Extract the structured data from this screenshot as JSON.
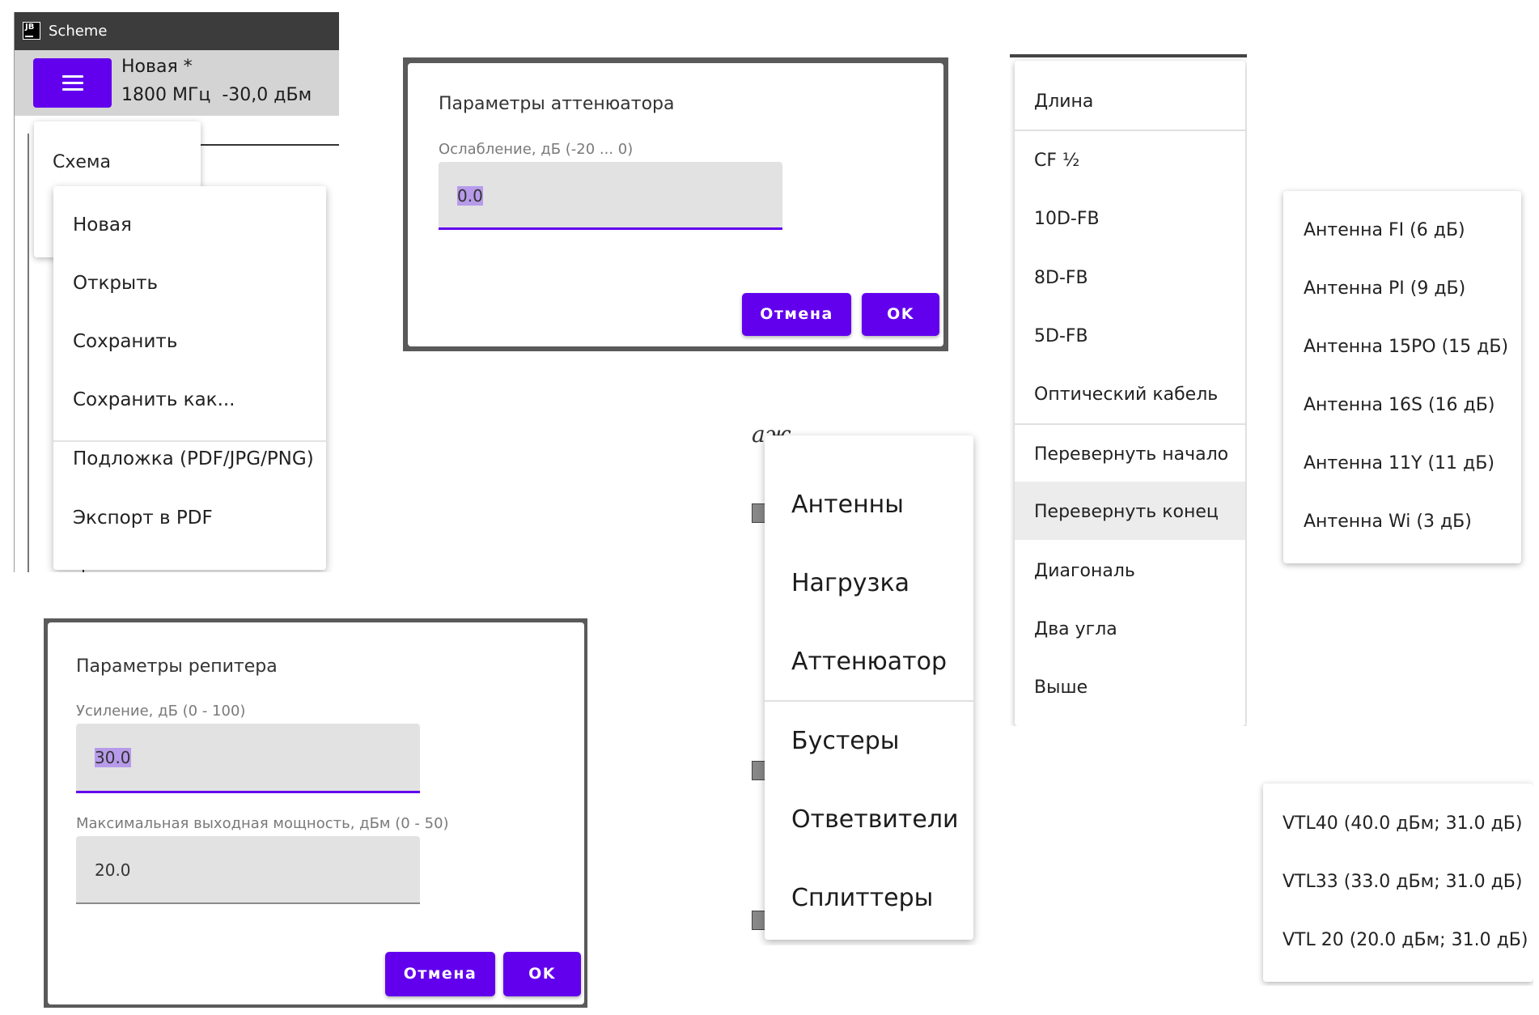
{
  "app_window": {
    "title": "Scheme",
    "logo": "JB",
    "document": {
      "name": "Новая *",
      "frequency": "1800 МГц",
      "level": "-30,0 дБм"
    },
    "menu_button_icon": "hamburger-icon",
    "top_menu": {
      "items": [
        "Схема"
      ]
    },
    "file_menu": {
      "items": [
        "Новая",
        "Открыть",
        "Сохранить",
        "Сохранить как...",
        "Подложка (PDF/JPG/PNG)",
        "Экспорт в PDF"
      ]
    }
  },
  "attenuator_dialog": {
    "title": "Параметры аттенюатора",
    "field_label": "Ослабление, дБ (-20 ... 0)",
    "field_value": "0.0",
    "cancel_label": "Отмена",
    "ok_label": "OK"
  },
  "repeater_dialog": {
    "title": "Параметры репитера",
    "gain_label": "Усиление, дБ (0 - 100)",
    "gain_value": "30.0",
    "power_label": "Максимальная выходная мощность, дБм (0 - 50)",
    "power_value": "20.0",
    "cancel_label": "Отмена",
    "ok_label": "OK"
  },
  "category_menu": {
    "background_text": "аж",
    "items": [
      "Антенны",
      "Нагрузка",
      "Аттенюатор",
      "Бустеры",
      "Ответвители",
      "Сплиттеры"
    ]
  },
  "cable_menu": {
    "items": [
      "Длина",
      "CF ½",
      "10D-FB",
      "8D-FB",
      "5D-FB",
      "Оптический кабель",
      "Перевернуть начало",
      "Перевернуть конец",
      "Диагональ",
      "Два угла",
      "Выше"
    ],
    "highlighted": "Перевернуть конец"
  },
  "antenna_menu": {
    "items": [
      "Антенна FI (6 дБ)",
      "Антенна PI (9 дБ)",
      "Антенна 15PO (15 дБ)",
      "Антенна 16S (16 дБ)",
      "Антенна 11Y (11 дБ)",
      "Антенна Wi (3 дБ)"
    ]
  },
  "booster_menu": {
    "items": [
      "VTL40 (40.0 дБм; 31.0 дБ)",
      "VTL33 (33.0 дБм; 31.0 дБ)",
      "VTL 20 (20.0 дБм; 31.0 дБ)"
    ]
  },
  "colors": {
    "accent": "#6200ee",
    "titlebar": "#3c3c3c",
    "toolbar": "#d4d4d4",
    "field_bg": "#e2e2e2"
  }
}
